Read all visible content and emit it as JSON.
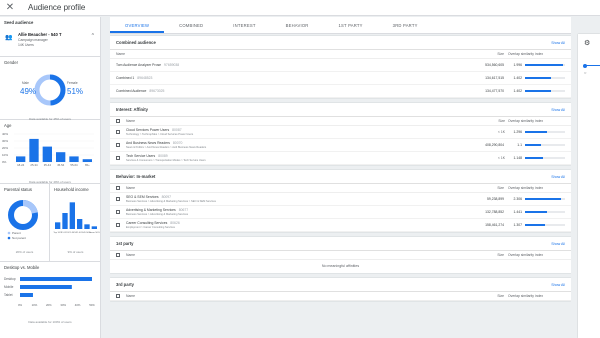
{
  "header": {
    "close_icon": "close-icon",
    "title": "Audience profile"
  },
  "seed": {
    "heading": "Seed audience",
    "name": "Allie Beaucher - 540 T",
    "subtitle": "Campaign manager",
    "users": "14K Users"
  },
  "gender": {
    "title": "Gender",
    "items": [
      {
        "label": "Male",
        "pct": "49%",
        "value": 49
      },
      {
        "label": "Female",
        "pct": "51%",
        "value": 51
      }
    ],
    "footnote": "Data available for 45% of users",
    "colors": {
      "primary": "#1a73e8",
      "light": "#a8c7fa"
    }
  },
  "age": {
    "title": "Age",
    "yticks": [
      "40%",
      "30%",
      "20%",
      "10%",
      "0%"
    ],
    "categories": [
      "18-24",
      "25-34",
      "35-44",
      "45-54",
      "55-64",
      "65+"
    ],
    "values": [
      8,
      33,
      22,
      14,
      8,
      4
    ],
    "footnote": "Data available for 49% of users"
  },
  "parental": {
    "title": "Parental status",
    "legend": [
      "Parent",
      "Not parent"
    ],
    "values": [
      22,
      78
    ],
    "footnote": "20% of users"
  },
  "household": {
    "title": "Household income",
    "categories": [
      "Top 10%",
      "11-20%",
      "21-30%",
      "31-40%",
      "41-50%",
      "Lower 50%"
    ],
    "values": [
      10,
      24,
      40,
      15,
      7,
      4
    ],
    "footnote": "9% of users"
  },
  "device": {
    "title": "Desktop vs. Mobile",
    "categories": [
      "Desktop",
      "Mobile",
      "Tablet"
    ],
    "values": [
      62,
      36,
      9
    ],
    "xticks": [
      "0%",
      "10%",
      "20%",
      "30%",
      "40%",
      "50%"
    ],
    "footnote": "Data available for 100% of users"
  },
  "tabs": [
    "OVERVIEW",
    "COMBINED",
    "INTEREST",
    "BEHAVIOR",
    "1ST PARTY",
    "3RD PARTY"
  ],
  "combined": {
    "title": "Combined audience",
    "show_all": "Show All",
    "columns": {
      "name": "Name",
      "size": "Size",
      "overlap": "Overlap similarity index"
    },
    "rows": [
      {
        "name": "Tom Audience Analyzer Prose",
        "id": "97659038",
        "size": "534,560,605",
        "overlap": "1.996",
        "fill": 0.95
      },
      {
        "name": "Combined 1",
        "id": "89648523",
        "size": "134,617,515",
        "overlap": "1.402",
        "fill": 0.65
      },
      {
        "name": "Combined Audience",
        "id": "89673025",
        "size": "134,477,570",
        "overlap": "1.402",
        "fill": 0.65
      }
    ]
  },
  "interest": {
    "title": "Interest: Affinity",
    "show_all": "Show All",
    "columns": {
      "name": "Name",
      "size": "Size",
      "overlap": "Overlap similarity index"
    },
    "rows": [
      {
        "name": "Cloud Services Power Users",
        "id": "80087",
        "sub": "Technology > Technophiles > Cloud Services Power Users",
        "size": "< 1K",
        "overlap": "1.296",
        "fill": 0.55
      },
      {
        "name": "And Business News Readers",
        "id": "80070",
        "sub": "News & Politics > Avid News Readers > Avid Business News Readers",
        "size": "408,290,804",
        "overlap": "1.1",
        "fill": 0.4
      },
      {
        "name": "Tech Service Users",
        "id": "80089",
        "sub": "Services & Consumers > Transportation Modes > Tech Service Users",
        "size": "< 1K",
        "overlap": "1.148",
        "fill": 0.45
      }
    ]
  },
  "behavior": {
    "title": "Behavior: In-market",
    "show_all": "Show All",
    "columns": {
      "name": "Name",
      "size": "Size",
      "overlap": "Overlap similarity index"
    },
    "rows": [
      {
        "name": "SEO & SEM Services",
        "id": "80097",
        "sub": "Business Services > Advertising & Marketing Services > SEO & SEM Services",
        "size": "59,238,899",
        "overlap": "2.306",
        "fill": 0.9
      },
      {
        "name": "Advertising & Marketing Services",
        "id": "80677",
        "sub": "Business Services > Advertising & Marketing Services",
        "size": "132,788,852",
        "overlap": "1.441",
        "fill": 0.55
      },
      {
        "name": "Career Consulting Services",
        "id": "80626",
        "sub": "Employment > Career Consulting Services",
        "size": "158,461,274",
        "overlap": "1.307",
        "fill": 0.5
      }
    ]
  },
  "first_party": {
    "title": "1st party",
    "show_all": "Show All",
    "columns": {
      "name": "Name",
      "size": "Size",
      "overlap": "Overlap similarity index"
    },
    "empty": "No meaningful affinities"
  },
  "third_party": {
    "title": "3rd party",
    "show_all": "Show All",
    "columns": {
      "name": "Name",
      "size": "Size",
      "overlap": "Overlap similarity index"
    }
  }
}
